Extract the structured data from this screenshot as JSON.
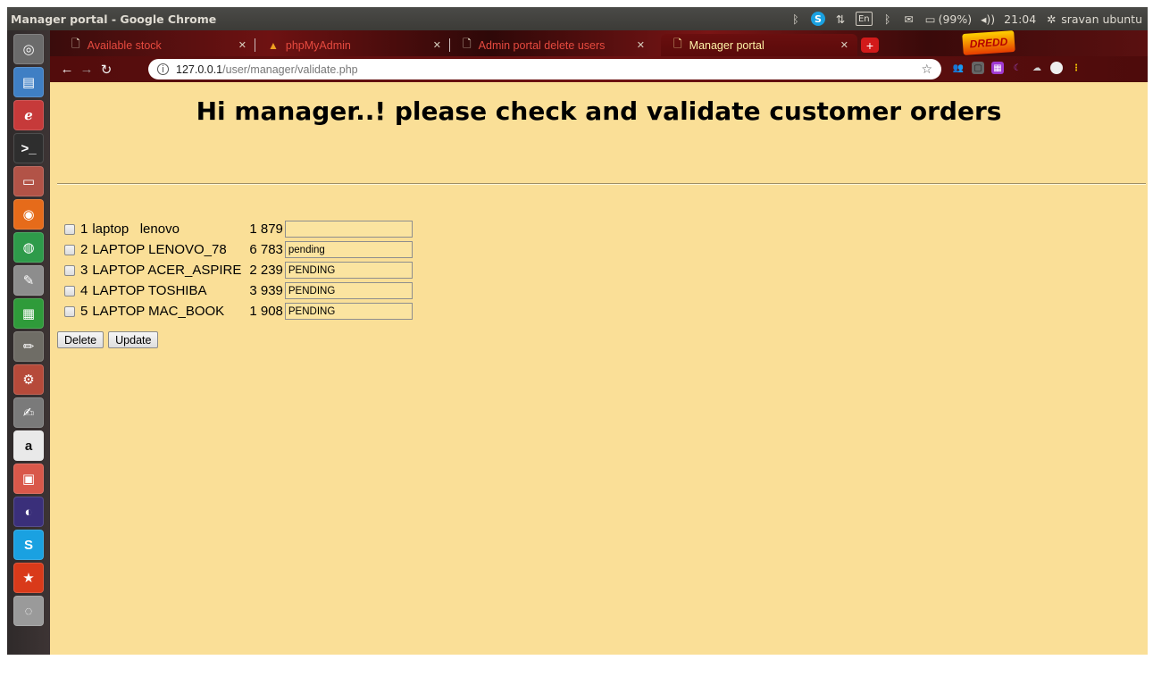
{
  "os_panel": {
    "window_title": "Manager portal - Google Chrome",
    "battery": "(99%)",
    "clock": "21:04",
    "user": "sravan ubuntu",
    "keyboard_layout": "En"
  },
  "launcher": {
    "apps": [
      {
        "name": "dash-icon",
        "glyph": "◎",
        "color": "#6b6b6b"
      },
      {
        "name": "files-icon",
        "glyph": "▤",
        "color": "#3f7fc4"
      },
      {
        "name": "flow-app-icon",
        "glyph": "ℯ",
        "color": "#c63a3a"
      },
      {
        "name": "terminal-icon",
        "glyph": ">_",
        "color": "#2e2e2e"
      },
      {
        "name": "archive-icon",
        "glyph": "▭",
        "color": "#b25347"
      },
      {
        "name": "firefox-icon",
        "glyph": "◉",
        "color": "#e66b1a"
      },
      {
        "name": "chrome-icon",
        "glyph": "◍",
        "color": "#2e9b4a"
      },
      {
        "name": "text-editor-icon",
        "glyph": "✎",
        "color": "#8d8d8d"
      },
      {
        "name": "spreadsheet-icon",
        "glyph": "▦",
        "color": "#2f9b3a"
      },
      {
        "name": "pencil-icon",
        "glyph": "✏",
        "color": "#6f6d66"
      },
      {
        "name": "settings-icon",
        "glyph": "⚙",
        "color": "#b64a3a"
      },
      {
        "name": "notes-icon",
        "glyph": "✍",
        "color": "#7a7a7a"
      },
      {
        "name": "amazon-icon",
        "glyph": "a",
        "color": "#e9e9e9"
      },
      {
        "name": "calendar-icon",
        "glyph": "▣",
        "color": "#d9584a"
      },
      {
        "name": "eclipse-icon",
        "glyph": "◐",
        "color": "#3a2f7a"
      },
      {
        "name": "skype-icon",
        "glyph": "S",
        "color": "#1aa1e1"
      },
      {
        "name": "star-app-icon",
        "glyph": "★",
        "color": "#d93a1a"
      },
      {
        "name": "disc-icon",
        "glyph": "◌",
        "color": "#9a9a9a"
      }
    ]
  },
  "browser": {
    "tabs": [
      {
        "title": "Available stock",
        "active": false
      },
      {
        "title": "phpMyAdmin",
        "active": false
      },
      {
        "title": "Admin portal delete users",
        "active": false
      },
      {
        "title": "Manager portal",
        "active": true
      }
    ],
    "url_host": "127.0.0.1",
    "url_path": "/user/manager/validate.php"
  },
  "page": {
    "heading": "Hi manager..! please check and validate customer orders",
    "orders": [
      {
        "id": "1",
        "name": "laptop   lenovo",
        "qty": "1 879",
        "status": ""
      },
      {
        "id": "2",
        "name": "LAPTOP LENOVO_78",
        "qty": "6 783",
        "status": "pending"
      },
      {
        "id": "3",
        "name": "LAPTOP ACER_ASPIRE",
        "qty": "2 239",
        "status": "PENDING"
      },
      {
        "id": "4",
        "name": "LAPTOP TOSHIBA",
        "qty": "3 939",
        "status": "PENDING"
      },
      {
        "id": "5",
        "name": "LAPTOP MAC_BOOK",
        "qty": "1 908",
        "status": "PENDING"
      }
    ],
    "delete_label": "Delete",
    "update_label": "Update"
  }
}
